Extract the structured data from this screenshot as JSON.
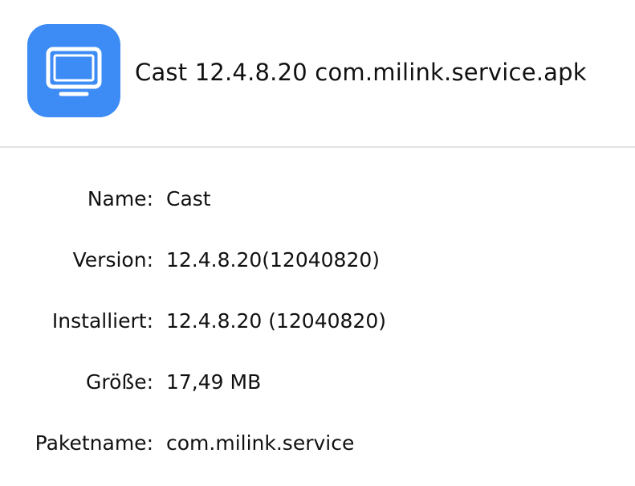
{
  "header": {
    "icon": "monitor-icon",
    "icon_color": "#3d8bf5",
    "title": "Cast 12.4.8.20 com.milink.service.apk"
  },
  "details": [
    {
      "label": "Name:",
      "value": "Cast"
    },
    {
      "label": "Version:",
      "value": "12.4.8.20(12040820)"
    },
    {
      "label": "Installiert:",
      "value": "12.4.8.20 (12040820)"
    },
    {
      "label": "Größe:",
      "value": "17,49 MB"
    },
    {
      "label": "Paketname:",
      "value": "com.milink.service"
    }
  ]
}
